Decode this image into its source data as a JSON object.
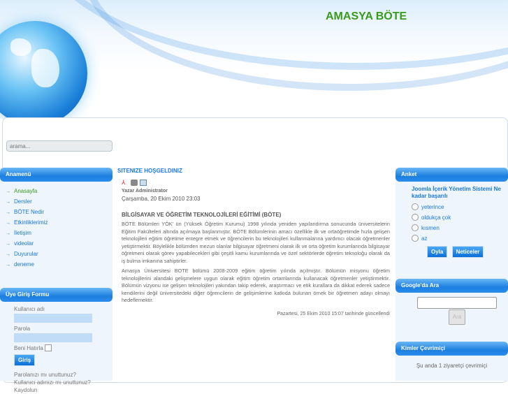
{
  "header": {
    "title": "AMASYA BÖTE",
    "search_placeholder": "arama..."
  },
  "left": {
    "menu_title": "Anamenü",
    "menu": [
      {
        "label": "Anasayfa",
        "active": true
      },
      {
        "label": "Dersler"
      },
      {
        "label": "BÖTE Nedir"
      },
      {
        "label": "Etkinliklerimiz"
      },
      {
        "label": "İletişim"
      },
      {
        "label": "videolar"
      },
      {
        "label": "Duyurular"
      },
      {
        "label": "deneme"
      }
    ],
    "login_title": "Üye Giriş Formu",
    "username_label": "Kullanıcı adı",
    "password_label": "Parola",
    "remember_label": "Beni Hatırla",
    "login_button": "Giriş",
    "forgot_password": "Parolanızı mı unuttunuz?",
    "forgot_username": "Kullanıcı adınızı mı unuttunuz?",
    "register": "Kaydolun"
  },
  "article": {
    "title": "SITENIZE HOŞGELDINIZ",
    "icons": [
      "pdf-icon",
      "print-icon",
      "email-icon"
    ],
    "author": "Yazar Administrator",
    "date": "Çarşamba, 20 Ekim 2010 23:03",
    "heading": "BİLGİSAYAR VE ÖĞRETİM TEKNOLOJİLERİ EĞİTİMİ (BÖTE)",
    "p1": "BÖTE Bölümleri YÖK' ün (Yüksek Öğretim Kurumu) 1998 yılında yeniden yapılandırma sonucunda üniversitelerin Eğitim Fakülteleri altında açılmaya başlanmıştır. BÖTE Bölümlerinin amacı özellikle ilk ve ortaöğretimde hızla gelişen teknolojileri eğitim öğretime entegre etmek ve öğrencilerin bu teknolojileri kullanmalarına yardımcı olacak öğretmenler yetiştirmektir. Böylelikle bölümden mezun olanlar bilgisayar öğretmeni olarak ilk ve orta öğretim kurumlarında bilgisayar öğretmeni olarak görev yapabilecekleri gibi çeşitli kamu kurumlarında ve özel sektörlerde öğretim teknoloğu olarak da iş bulma imkanına sahiptirler.",
    "p2": "Amasya Üniversitesi BOTE bölümü 2008-2009 eğitim öğretim yılında açılmıştır. Bölümün misyonu öğretim teknolojilerini alandaki gelişmelere uygun olarak eğitim öğretim ortamlarında kullanacak öğretmenler yetiştirmektir. Bölümün vizyonu ise gelişen teknolojileri yakından takip ederek, araştırmacı ve etik kurallara da dikkat ederek sadece kendilerini değil üniversitedeki diğer öğrencilerin de gelişimlerine katkıda bulunan örnek bir öğretmen adayı olmayı hedeflemektir.",
    "modified": "Pazartesi, 25 Ekim 2010 15:07 tarihinde güncellendi"
  },
  "right": {
    "poll_title": "Anket",
    "poll_question": "Joomla İçerik Yönetim Sistemi Ne kadar başarılı",
    "options": [
      "yeterince",
      "oldukça çok",
      "kısmen",
      "az"
    ],
    "vote_button": "Oyla",
    "results_button": "Neticeler",
    "google_title": "Google'da Ara",
    "google_button": "Ara",
    "online_title": "Kimler Çevrimiçi",
    "online_text": "Şu anda 1 ziyaretçi çevrimiçi"
  }
}
